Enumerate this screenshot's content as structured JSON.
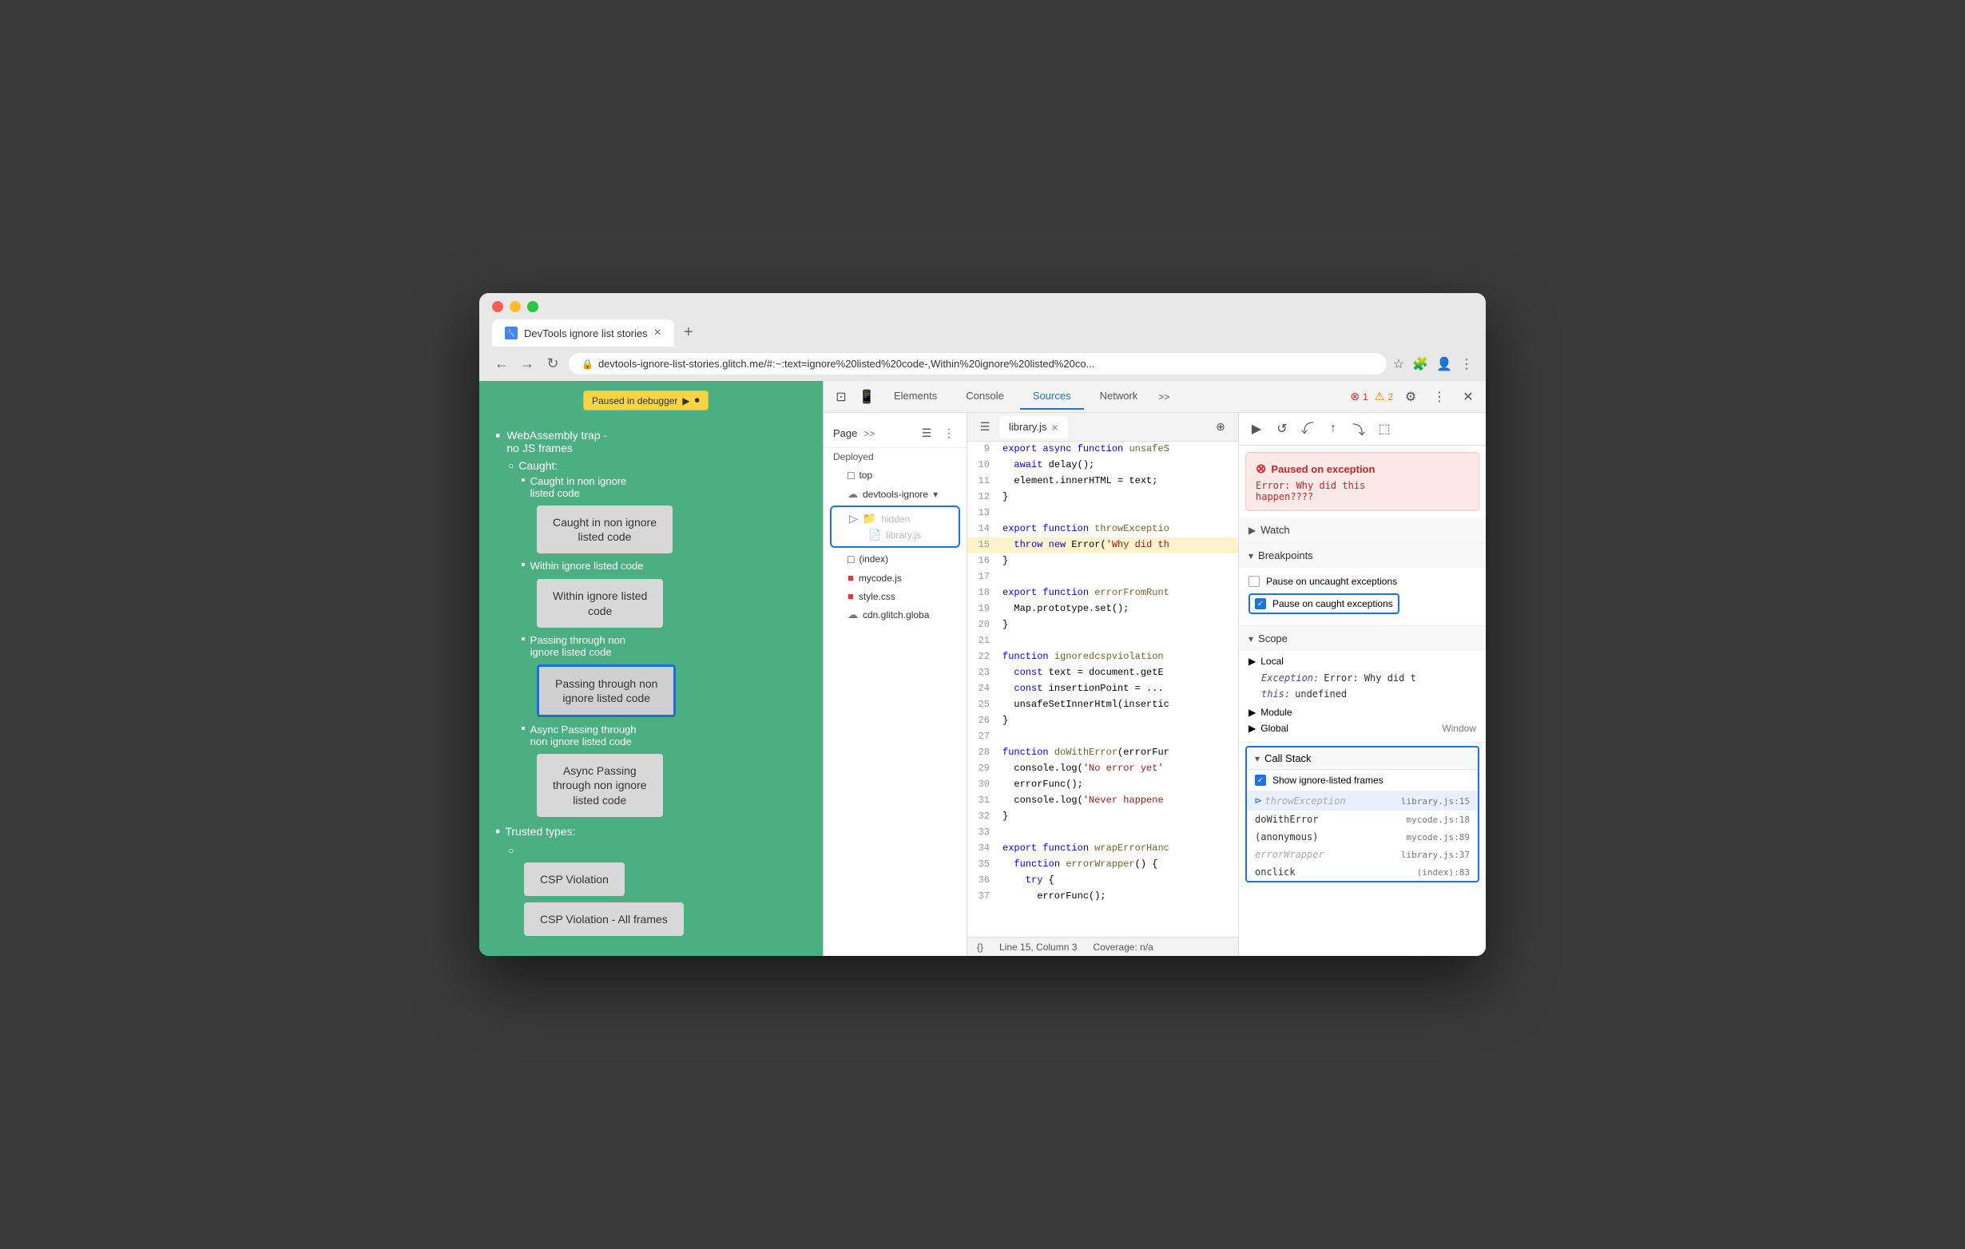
{
  "browser": {
    "tab_title": "DevTools ignore list stories",
    "address": "devtools-ignore-list-stories.glitch.me/#:~:text=ignore%20listed%20code-,Within%20ignore%20listed%20co...",
    "nav": {
      "back": "←",
      "forward": "→",
      "refresh": "↻"
    }
  },
  "debugger_banner": "Paused in debugger",
  "page": {
    "sections": [
      {
        "type": "list-header",
        "text": "WebAssembly trap - no JS frames",
        "indent": 1
      },
      {
        "type": "subsection",
        "text": "Caught:"
      },
      {
        "type": "list-item",
        "text": "Caught in non ignore listed code"
      },
      {
        "type": "button",
        "text": "Caught in non ignore\nlisted code"
      },
      {
        "type": "list-item",
        "text": "Within ignore listed code"
      },
      {
        "type": "button",
        "text": "Within ignore listed\ncode"
      },
      {
        "type": "list-item",
        "text": "Passing through non ignore listed code"
      },
      {
        "type": "button-active",
        "text": "Passing through non\nignore listed code"
      },
      {
        "type": "list-item",
        "text": "Async Passing through non ignore listed code"
      },
      {
        "type": "button",
        "text": "Async Passing\nthrough non ignore\nlisted code"
      }
    ],
    "trusted_types": {
      "header": "Trusted types:",
      "items": [
        "CSP Violation",
        "CSP Violation - All frames"
      ]
    }
  },
  "devtools": {
    "tabs": [
      "Elements",
      "Console",
      "Sources",
      "Network"
    ],
    "active_tab": "Sources",
    "toolbar_icons": [
      "⊞",
      "☰",
      "⚙",
      "⋮",
      "✕"
    ],
    "error_count": "1",
    "warn_count": "2"
  },
  "sources": {
    "panel_tabs": [
      "Page"
    ],
    "file_tree": {
      "items": [
        {
          "name": "Deployed",
          "type": "header",
          "indent": 0
        },
        {
          "name": "top",
          "type": "folder",
          "indent": 1
        },
        {
          "name": "devtools-ignore",
          "type": "cloud-folder",
          "indent": 1
        },
        {
          "name": "hidden",
          "type": "folder-highlighted",
          "indent": 2
        },
        {
          "name": "library.js",
          "type": "file-gray",
          "indent": 3
        },
        {
          "name": "(index)",
          "type": "file",
          "indent": 2
        },
        {
          "name": "mycode.js",
          "type": "file-red",
          "indent": 2
        },
        {
          "name": "style.css",
          "type": "file-red",
          "indent": 2
        },
        {
          "name": "cdn.glitch.globa",
          "type": "cloud-folder",
          "indent": 1
        }
      ]
    },
    "open_file": "library.js",
    "code_lines": [
      {
        "num": 9,
        "content": "export async function unsafeS",
        "highlight": false
      },
      {
        "num": 10,
        "content": "  await delay();",
        "highlight": false
      },
      {
        "num": 11,
        "content": "  element.innerHTML = text;",
        "highlight": false
      },
      {
        "num": 12,
        "content": "}",
        "highlight": false
      },
      {
        "num": 13,
        "content": "",
        "highlight": false
      },
      {
        "num": 14,
        "content": "export function throwExceptio",
        "highlight": false
      },
      {
        "num": 15,
        "content": "  throw new Error('Why did th",
        "highlight": true
      },
      {
        "num": 16,
        "content": "}",
        "highlight": false
      },
      {
        "num": 17,
        "content": "",
        "highlight": false
      },
      {
        "num": 18,
        "content": "export function errorFromRunt",
        "highlight": false
      },
      {
        "num": 19,
        "content": "  Map.prototype.set();",
        "highlight": false
      },
      {
        "num": 20,
        "content": "}",
        "highlight": false
      },
      {
        "num": 21,
        "content": "",
        "highlight": false
      },
      {
        "num": 22,
        "content": "function ignoredcspviolation",
        "highlight": false
      },
      {
        "num": 23,
        "content": "  const text = document.getE",
        "highlight": false
      },
      {
        "num": 24,
        "content": "  const insertionPoint = ...",
        "highlight": false
      },
      {
        "num": 25,
        "content": "  unsafeSetInnerHtml(insertic",
        "highlight": false
      },
      {
        "num": 26,
        "content": "}",
        "highlight": false
      },
      {
        "num": 27,
        "content": "",
        "highlight": false
      },
      {
        "num": 28,
        "content": "function doWithError(errorFur",
        "highlight": false
      },
      {
        "num": 29,
        "content": "  console.log('No error yet'",
        "highlight": false
      },
      {
        "num": 30,
        "content": "  errorFunc();",
        "highlight": false
      },
      {
        "num": 31,
        "content": "  console.log('Never happene",
        "highlight": false
      },
      {
        "num": 32,
        "content": "}",
        "highlight": false
      },
      {
        "num": 33,
        "content": "",
        "highlight": false
      },
      {
        "num": 34,
        "content": "export function wrapErrorHanc",
        "highlight": false
      },
      {
        "num": 35,
        "content": "  function errorWrapper() {",
        "highlight": false
      },
      {
        "num": 36,
        "content": "    try {",
        "highlight": false
      },
      {
        "num": 37,
        "content": "      errorFunc();",
        "highlight": false
      }
    ],
    "statusbar": {
      "position": "Line 15, Column 3",
      "coverage": "Coverage: n/a"
    }
  },
  "right_panel": {
    "debug_buttons": [
      "▶",
      "↺",
      "↓",
      "↑",
      "⤵",
      "⬚"
    ],
    "exception": {
      "title": "Paused on exception",
      "message": "Error: Why did this\nhappen????"
    },
    "watch": {
      "label": "Watch"
    },
    "breakpoints": {
      "label": "Breakpoints",
      "items": [
        {
          "label": "Pause on uncaught exceptions",
          "checked": false
        },
        {
          "label": "Pause on caught exceptions",
          "checked": true,
          "highlighted": true
        }
      ]
    },
    "scope": {
      "label": "Scope",
      "local": {
        "label": "Local",
        "items": [
          {
            "key": "Exception:",
            "value": "Error: Why did t"
          },
          {
            "key": "this:",
            "value": "undefined"
          }
        ]
      },
      "module": {
        "label": "Module"
      },
      "global": {
        "label": "Global",
        "value": "Window"
      }
    },
    "call_stack": {
      "label": "Call Stack",
      "show_ignore_frames": true,
      "frames": [
        {
          "name": "throwException",
          "location": "library.js:15",
          "active": true,
          "dimmed": true,
          "arrow": true
        },
        {
          "name": "doWithError",
          "location": "mycode.js:18",
          "active": false,
          "dimmed": false
        },
        {
          "name": "(anonymous)",
          "location": "mycode.js:89",
          "active": false,
          "dimmed": false
        },
        {
          "name": "errorWrapper",
          "location": "library.js:37",
          "active": false,
          "dimmed": true
        },
        {
          "name": "onclick",
          "location": "(index):83",
          "active": false,
          "dimmed": false
        }
      ]
    }
  }
}
